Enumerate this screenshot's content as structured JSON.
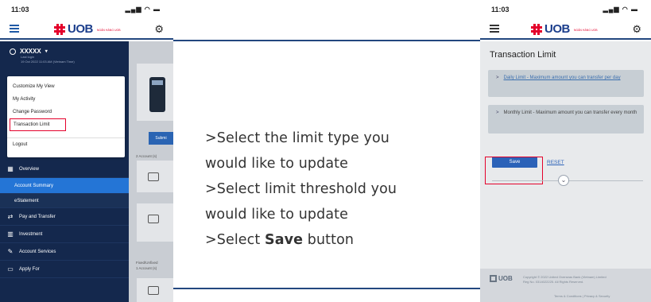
{
  "left_phone": {
    "status_time": "11:03",
    "logo_text": "UOB",
    "logo_sub": "NGÂN HÀNG UOB",
    "username": "XXXXX",
    "last_login_label": "Last login",
    "last_login_time": "19 Oct 2022 11:03 AM (Vietnam Time)",
    "menu": [
      "Customize My View",
      "My Activity",
      "Change Password",
      "Transaction Limit",
      "Logout"
    ],
    "nav": {
      "overview": "Overview",
      "account_summary": "Account Summary",
      "estatement": "eStatement",
      "pay_transfer": "Pay and Transfer",
      "investment": "Investment",
      "account_services": "Account Services",
      "apply_for": "Apply For"
    },
    "bg": {
      "submit": "Submi",
      "accounts": "2 Account (s)",
      "fixed": "Fixed/Unfixed",
      "fixed_count": "1 Account (s)"
    }
  },
  "instructions": {
    "line1": ">Select the limit type you",
    "line2": "would like to update",
    "line3": ">Select limit threshold you",
    "line4": "would like to update",
    "line5_prefix": ">Select ",
    "line5_bold": "Save",
    "line5_suffix": " button"
  },
  "right_phone": {
    "status_time": "11:03",
    "logo_text": "UOB",
    "logo_sub": "NGÂN HÀNG UOB",
    "title": "Transaction Limit",
    "daily_limit": "Daily Limit - Maximum amount you can transfer per day",
    "monthly_limit": "Monthly Limit - Maximum amount you can transfer every month",
    "save": "Save",
    "reset": "RESET",
    "footer_logo": "UOB",
    "footer_copyright": "Copyright © 2022 United Overseas Bank (Vietnam) Limited",
    "footer_reg": "Reg No. 0314022225. All Rights Reserved.",
    "footer_links": "Terms & Conditions   |   Privacy & Security"
  },
  "colors": {
    "brand_red": "#e4002b",
    "brand_navy": "#14284d",
    "accent_blue": "#2475d6"
  }
}
